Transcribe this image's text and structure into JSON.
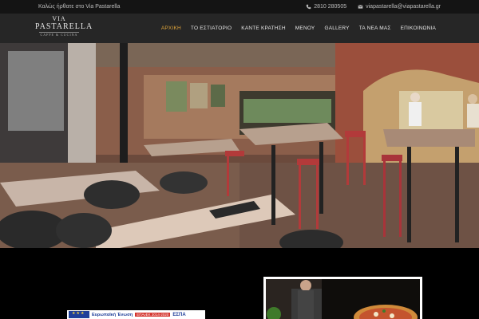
{
  "topbar": {
    "welcome": "Καλώς ήρθατε στο Via Pastarella",
    "phone": "2810 280505",
    "email": "viapastarella@viapastarella.gr",
    "phone_icon": "phone-icon",
    "email_icon": "envelope-icon"
  },
  "logo": {
    "line1": "VIA",
    "line2": "PASTARELLA",
    "line3": "CAFFE & CUCINA"
  },
  "nav": {
    "items": [
      {
        "label": "ΑΡΧΙΚΗ",
        "active": true
      },
      {
        "label": "ΤΟ ΕΣΤΙΑΤΟΡΙΟ",
        "active": false
      },
      {
        "label": "ΚΑΝΤΕ ΚΡΑΤΗΣΗ",
        "active": false
      },
      {
        "label": "ΜΕΝΟΥ",
        "active": false
      },
      {
        "label": "GALLERY",
        "active": false
      },
      {
        "label": "ΤΑ ΝΕΑ ΜΑΣ",
        "active": false
      },
      {
        "label": "ΕΠΙΚΟΙΝΩΝΙΑ",
        "active": false
      }
    ],
    "active_color": "#e0a53a"
  },
  "banner": {
    "text1": "Ευρωπαϊκή Ένωση",
    "text2": "ΕΠΑνΕΚ 2014-2020",
    "text3": "ΕΣΠΑ"
  },
  "colors": {
    "topbar_bg": "#141414",
    "header_bg": "#262626",
    "page_bg": "#000000"
  }
}
